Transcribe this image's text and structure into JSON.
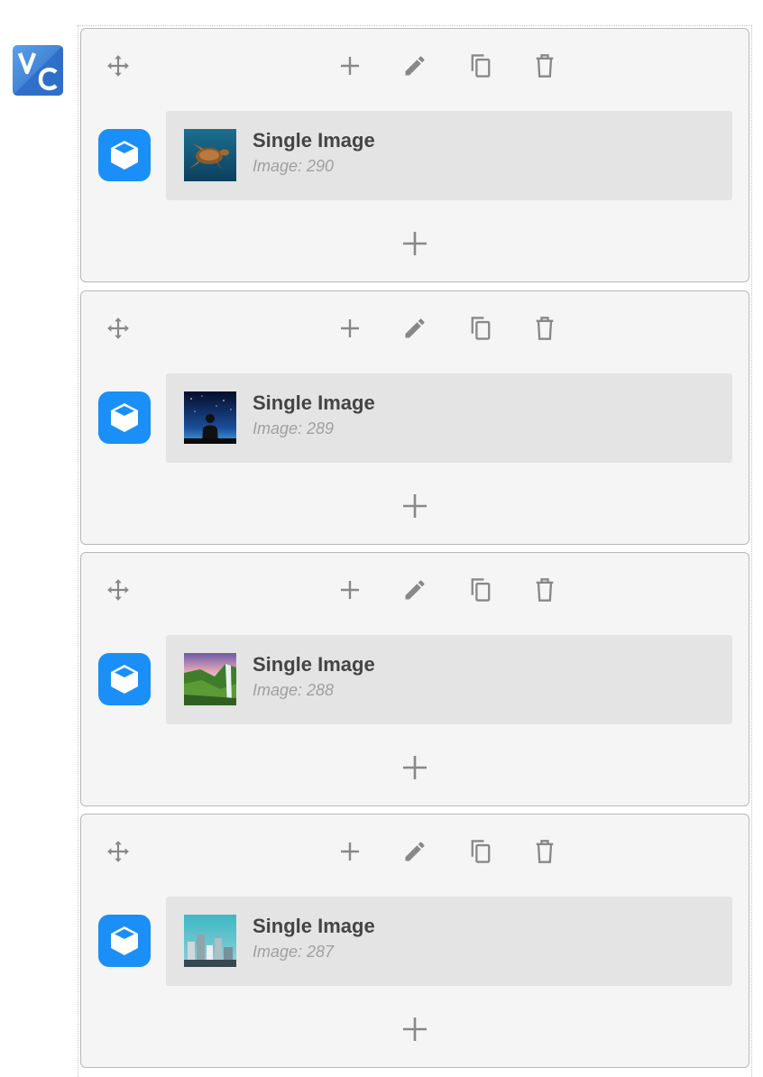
{
  "logo": {
    "name": "vc-logo",
    "accent": "#3a7bd5",
    "letters": [
      "V",
      "C"
    ]
  },
  "colors": {
    "row_bg": "#f5f5f5",
    "element_bg": "#e4e4e4",
    "badge_blue": "#1a8ff7",
    "icon_gray": "#888888",
    "title": "#444444",
    "subtitle": "#a0a0a0"
  },
  "controls": {
    "move_icon": "move-arrows-icon",
    "add_icon": "plus-icon",
    "edit_icon": "pencil-icon",
    "copy_icon": "copy-icon",
    "delete_icon": "trash-icon"
  },
  "rows": [
    {
      "element": {
        "title": "Single Image",
        "subtitle": "Image: 290",
        "thumbnail": "sea-turtle"
      }
    },
    {
      "element": {
        "title": "Single Image",
        "subtitle": "Image: 289",
        "thumbnail": "person-under-night-sky"
      }
    },
    {
      "element": {
        "title": "Single Image",
        "subtitle": "Image: 288",
        "thumbnail": "waterfall-valley"
      }
    },
    {
      "element": {
        "title": "Single Image",
        "subtitle": "Image: 287",
        "thumbnail": "city-skyline-aerial"
      }
    }
  ]
}
